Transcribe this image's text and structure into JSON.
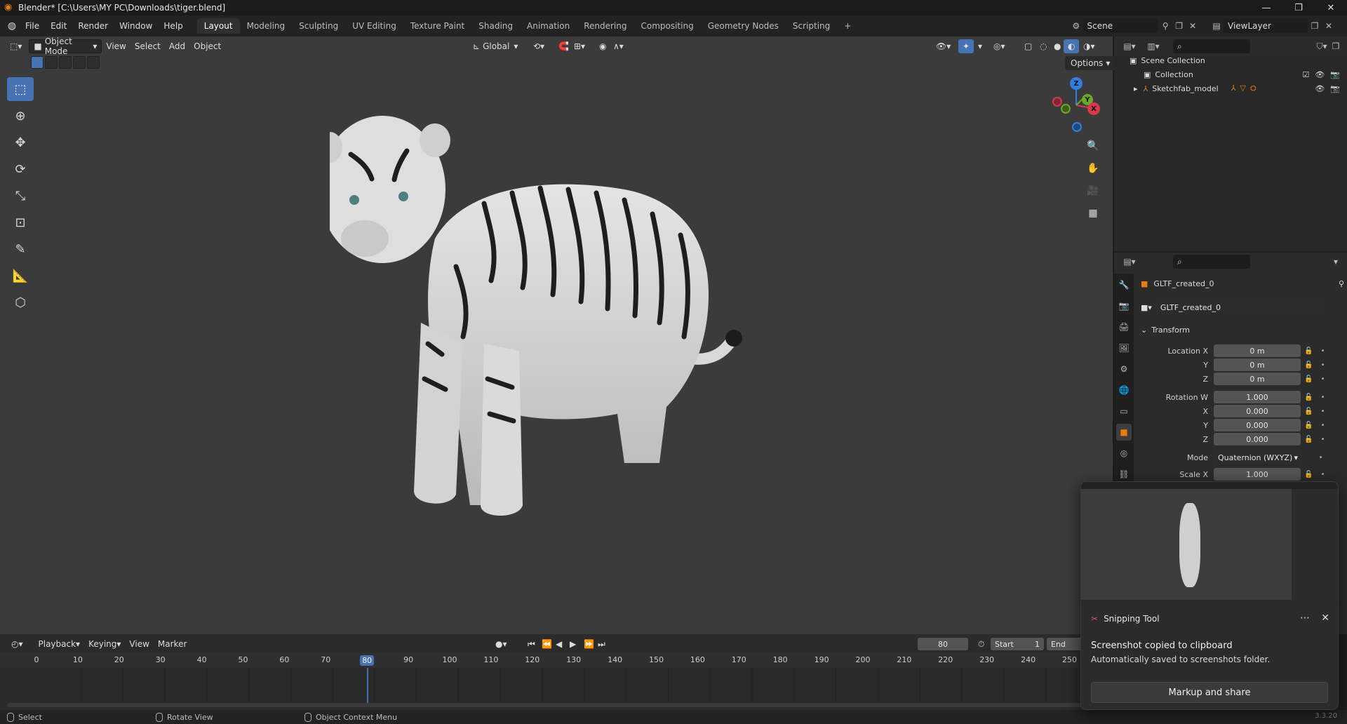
{
  "window": {
    "title": "Blender* [C:\\Users\\MY PC\\Downloads\\tiger.blend]",
    "controls": [
      "—",
      "❐",
      "✕"
    ]
  },
  "menubar": {
    "items": [
      "File",
      "Edit",
      "Render",
      "Window",
      "Help"
    ],
    "workspaces": [
      "Layout",
      "Modeling",
      "Sculpting",
      "UV Editing",
      "Texture Paint",
      "Shading",
      "Animation",
      "Rendering",
      "Compositing",
      "Geometry Nodes",
      "Scripting"
    ],
    "active_workspace": "Layout",
    "add_tab": "+",
    "scene": "Scene",
    "view_layer": "ViewLayer"
  },
  "viewport_header": {
    "mode": "Object Mode",
    "menus": [
      "View",
      "Select",
      "Add",
      "Object"
    ],
    "orientation": "Global",
    "options": "Options"
  },
  "gizmo": {
    "z": "Z",
    "y": "Y",
    "x": "X"
  },
  "outliner": {
    "root": "Scene Collection",
    "items": [
      {
        "name": "Collection"
      },
      {
        "name": "Sketchfab_model"
      }
    ]
  },
  "properties": {
    "object_name": "GLTF_created_0",
    "data_name": "GLTF_created_0",
    "section": "Transform",
    "location": {
      "label": "Location X",
      "x": "0 m",
      "y": "0 m",
      "z": "0 m"
    },
    "rotation": {
      "label": "Rotation W",
      "w": "1.000",
      "x": "0.000",
      "y": "0.000",
      "z": "0.000"
    },
    "axis_labels": {
      "x": "X",
      "y": "Y",
      "z": "Z"
    },
    "mode_label": "Mode",
    "mode_value": "Quaternion (WXYZ)",
    "scale": {
      "label": "Scale X",
      "x": "1.000"
    }
  },
  "timeline": {
    "menus": [
      "Playback",
      "Keying",
      "View",
      "Marker"
    ],
    "current_frame": "80",
    "start_label": "Start",
    "start_value": "1",
    "end_label": "End",
    "ticks": [
      "0",
      "10",
      "20",
      "30",
      "40",
      "50",
      "60",
      "70",
      "80",
      "90",
      "100",
      "110",
      "120",
      "130",
      "140",
      "150",
      "160",
      "170",
      "180",
      "190",
      "200",
      "210",
      "220",
      "230",
      "240",
      "250"
    ]
  },
  "statusbar": {
    "select": "Select",
    "rotate": "Rotate View",
    "context": "Object Context Menu",
    "version": "3.3.20"
  },
  "snipping_tool": {
    "app": "Snipping Tool",
    "message": "Screenshot copied to clipboard",
    "detail": "Automatically saved to screenshots folder.",
    "button": "Markup and share"
  },
  "colors": {
    "accent_blue": "#4772b3",
    "blender_orange": "#e87d0d",
    "viewport_bg": "#3b3b3b"
  }
}
